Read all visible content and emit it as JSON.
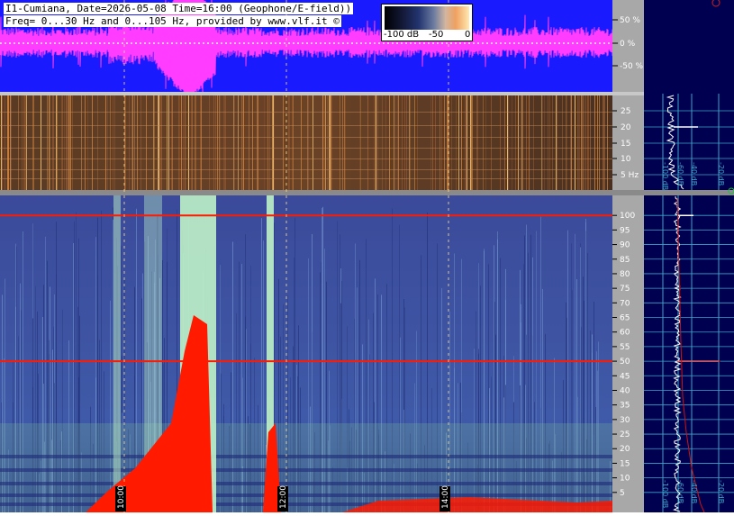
{
  "header": {
    "title_line": "I1-Cumiana, Date=2026-05-08 Time=16:00 (Geophone/E-field))",
    "freq_line": "Freq= 0...30 Hz and 0...105 Hz, provided by www.vlf.it ©"
  },
  "colorbar": {
    "labels": [
      "-100 dB",
      "-50",
      "0"
    ]
  },
  "colors": {
    "waveform_bg": "#1a1aff",
    "waveform_trace": "#ff3cff",
    "spectrum_panel_bg": "#000050",
    "saturation": "#ff1a00",
    "gridline": "#3da4c8"
  },
  "chart_data": [
    {
      "type": "line",
      "title": "",
      "description_role": "waveform amplitude strip",
      "yticks": [
        "50 %",
        "0 %",
        "-50 %"
      ],
      "ylim": [
        -100,
        100
      ],
      "unit": "%"
    },
    {
      "type": "heatmap",
      "description_role": "spectrogram 0–30 Hz",
      "yticks": [
        "25",
        "20",
        "15",
        "10",
        "5 Hz"
      ],
      "ylim": [
        0,
        30
      ],
      "unit": "Hz"
    },
    {
      "type": "heatmap",
      "description_role": "spectrogram 0–105 Hz",
      "yticks": [
        "100",
        "95",
        "90",
        "85",
        "80",
        "75",
        "70",
        "65",
        "60",
        "55",
        "50",
        "45",
        "40",
        "35",
        "30",
        "25",
        "20",
        "15",
        "10",
        "5"
      ],
      "ylim": [
        0,
        105
      ],
      "unit": "Hz",
      "time_markers": [
        "10:00",
        "12:00",
        "14:00"
      ],
      "lines_hz": [
        50,
        100
      ]
    },
    {
      "type": "line",
      "description_role": "mean spectrum (upper, 0–30 Hz)",
      "xticks": [
        "-100 dB",
        "-60 dB",
        "-40 dB",
        "-20 dB"
      ]
    },
    {
      "type": "line",
      "description_role": "mean spectrum (lower, 0–105 Hz)",
      "xticks": [
        "-100 dB",
        "-60 dB",
        "-40 dB",
        "-20 dB"
      ]
    }
  ]
}
